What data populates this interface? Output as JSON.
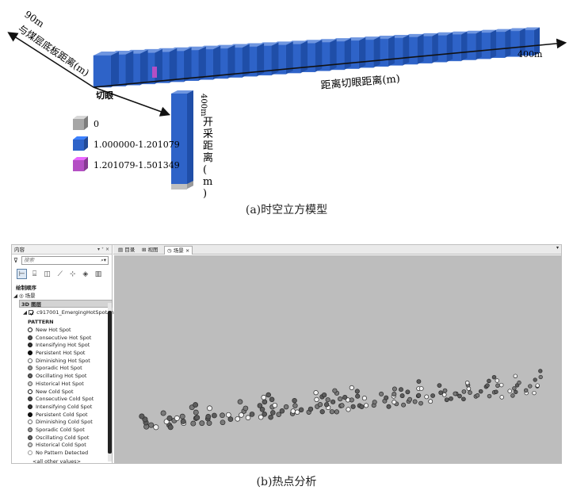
{
  "figure_a": {
    "axis_left_tick": "90m",
    "axis_left_label": "与煤层底板距离(m)",
    "axis_right_tick": "400m",
    "axis_right_label": "距离切眼距离(m)",
    "axis_down_tick": "400m",
    "axis_down_label": "开采距离(m)",
    "origin_label": "切眼",
    "legend": [
      {
        "label": "0",
        "color": "#a6a6a6"
      },
      {
        "label": "1.000000-1.201079",
        "color": "#2e63c8"
      },
      {
        "label": "1.201079-1.501349",
        "color": "#b44fc4"
      }
    ],
    "caption": "(a)时空立方模型"
  },
  "figure_b": {
    "panel_title": "内容",
    "panel_controls": "▾ ⁺ ×",
    "search_placeholder": "搜索",
    "section_drawing_order": "绘制顺序",
    "scene_node": "场景",
    "node_3d_layers": "3D 图层",
    "layer_name": "c917001_EmergingHotSpotAnaly",
    "pattern_heading": "PATTERN",
    "legend_items": [
      {
        "label": "New Hot Spot",
        "fill": "#ffffff",
        "ring": "#111111"
      },
      {
        "label": "Consecutive Hot Spot",
        "fill": "#555555",
        "ring": "#222222"
      },
      {
        "label": "Intensifying Hot Spot",
        "fill": "#333333",
        "ring": "#111111"
      },
      {
        "label": "Persistent Hot Spot",
        "fill": "#111111",
        "ring": "#000000"
      },
      {
        "label": "Diminishing Hot Spot",
        "fill": "#ffffff",
        "ring": "#666666"
      },
      {
        "label": "Sporadic Hot Spot",
        "fill": "#999999",
        "ring": "#444444"
      },
      {
        "label": "Oscillating Hot Spot",
        "fill": "#666666",
        "ring": "#222222"
      },
      {
        "label": "Historical Hot Spot",
        "fill": "#cccccc",
        "ring": "#555555"
      },
      {
        "label": "New Cold Spot",
        "fill": "#ffffff",
        "ring": "#111111"
      },
      {
        "label": "Consecutive Cold Spot",
        "fill": "#555555",
        "ring": "#222222"
      },
      {
        "label": "Intensifying Cold Spot",
        "fill": "#333333",
        "ring": "#111111"
      },
      {
        "label": "Persistent Cold Spot",
        "fill": "#111111",
        "ring": "#000000"
      },
      {
        "label": "Diminishing Cold Spot",
        "fill": "#ffffff",
        "ring": "#666666"
      },
      {
        "label": "Sporadic Cold Spot",
        "fill": "#999999",
        "ring": "#444444"
      },
      {
        "label": "Oscillating Cold Spot",
        "fill": "#666666",
        "ring": "#222222"
      },
      {
        "label": "Historical Cold Spot",
        "fill": "#cccccc",
        "ring": "#555555"
      },
      {
        "label": "No Pattern Detected",
        "fill": "#ffffff",
        "ring": "#999999"
      }
    ],
    "other_values": "<all other values>",
    "tabs": [
      "目录",
      "视图",
      "场景"
    ],
    "tab_close": "×",
    "tab_menu": "▾",
    "caption": "(b)热点分析"
  }
}
